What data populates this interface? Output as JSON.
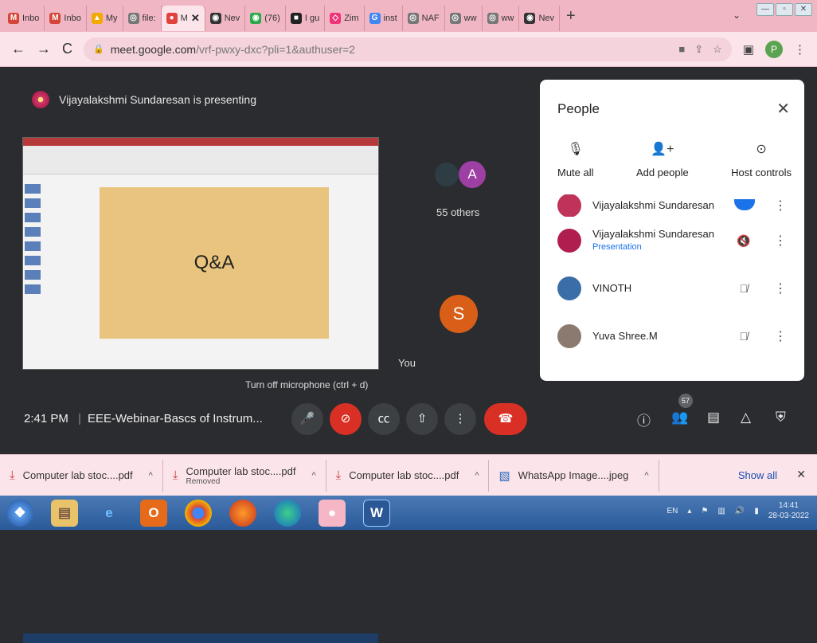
{
  "browser": {
    "tabs": [
      {
        "label": "Inbo",
        "icon": "M",
        "color": "#d44638"
      },
      {
        "label": "Inbo",
        "icon": "M",
        "color": "#d44638"
      },
      {
        "label": "My",
        "icon": "▲",
        "color": "#f2a900"
      },
      {
        "label": "file:",
        "icon": "◎",
        "color": "#777"
      },
      {
        "label": "M",
        "icon": "●",
        "color": "#e0433b",
        "active": true
      },
      {
        "label": "Nev",
        "icon": "◉",
        "color": "#333"
      },
      {
        "label": "(76)",
        "icon": "◉",
        "color": "#2aa84a"
      },
      {
        "label": "I gu",
        "icon": "■",
        "color": "#222"
      },
      {
        "label": "Zim",
        "icon": "◇",
        "color": "#e37"
      },
      {
        "label": "inst",
        "icon": "G",
        "color": "#4285f4"
      },
      {
        "label": "NAF",
        "icon": "◎",
        "color": "#777"
      },
      {
        "label": "ww",
        "icon": "◎",
        "color": "#777"
      },
      {
        "label": "ww",
        "icon": "◎",
        "color": "#777"
      },
      {
        "label": "Nev",
        "icon": "◉",
        "color": "#333"
      }
    ],
    "new_tab": "+",
    "url_host": "meet.google.com",
    "url_path": "/vrf-pwxy-dxc?pli=1&authuser=2",
    "profile_initial": "P"
  },
  "meet": {
    "presenting_text": "Vijayalakshmi Sundaresan is presenting",
    "slide_text": "Q&A",
    "you_label": "You",
    "mic_tooltip": "Turn off microphone (ctrl + d)",
    "avatar_a": "A",
    "others": "55 others",
    "avatar_s": "S",
    "time": "2:41 PM",
    "separator": "|",
    "meeting_title": "EEE-Webinar-Bascs of Instrum...",
    "participant_count": "57"
  },
  "people": {
    "title": "People",
    "actions": [
      {
        "label": "Mute all",
        "icon": "mic-off-icon",
        "glyph": "🎙"
      },
      {
        "label": "Add people",
        "icon": "add-person-icon",
        "glyph": "👤+"
      },
      {
        "label": "Host controls",
        "icon": "toggle-icon",
        "glyph": "⊙"
      }
    ],
    "participants": [
      {
        "name": "Vijayalakshmi Sundaresan",
        "sub": "",
        "avatar": "#c03358",
        "state": "speaking"
      },
      {
        "name": "Vijayalakshmi Sundaresan",
        "sub": "Presentation",
        "avatar": "#b01e50",
        "state": "presenting"
      },
      {
        "name": "VINOTH",
        "sub": "",
        "avatar": "#3a6ea8",
        "state": "muted"
      },
      {
        "name": "Yuva Shree.M",
        "sub": "",
        "avatar": "#8a7a70",
        "state": "muted"
      }
    ]
  },
  "downloads": {
    "items": [
      {
        "name": "Computer lab stoc....pdf",
        "sub": ""
      },
      {
        "name": "Computer lab stoc....pdf",
        "sub": "Removed"
      },
      {
        "name": "Computer lab stoc....pdf",
        "sub": ""
      },
      {
        "name": "WhatsApp Image....jpeg",
        "sub": ""
      }
    ],
    "show_all": "Show all"
  },
  "taskbar": {
    "lang": "EN",
    "time": "14:41",
    "date": "28-03-2022"
  }
}
